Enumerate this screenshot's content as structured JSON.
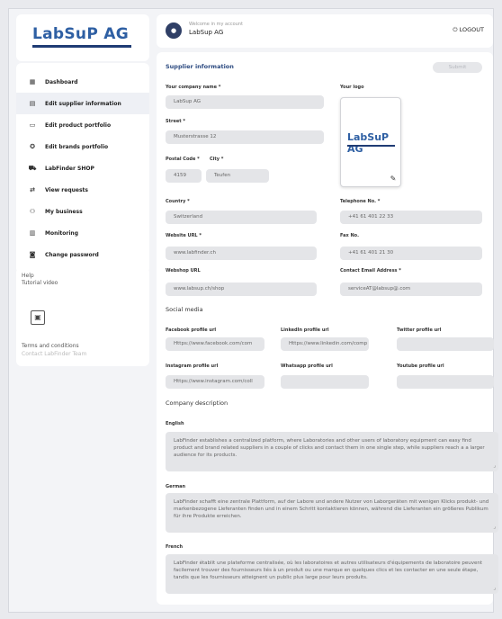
{
  "brand": {
    "logo_text": "LabSuP AG",
    "color": "#2e5fa3",
    "line_color": "#1f3c74"
  },
  "sidebar": {
    "items": [
      {
        "label": "Dashboard",
        "icon": "dashboard-icon"
      },
      {
        "label": "Edit supplier information",
        "icon": "supplier-icon",
        "active": true
      },
      {
        "label": "Edit product portfolio",
        "icon": "product-icon"
      },
      {
        "label": "Edit brands portfolio",
        "icon": "brands-icon"
      },
      {
        "label": "LabFinder SHOP",
        "icon": "shop-icon"
      },
      {
        "label": "View requests",
        "icon": "requests-icon"
      },
      {
        "label": "My business",
        "icon": "business-icon"
      },
      {
        "label": "Monitoring",
        "icon": "monitoring-icon"
      },
      {
        "label": "Change password",
        "icon": "password-icon"
      }
    ],
    "help": {
      "help": "Help",
      "tutorial": "Tutorial video",
      "terms": "Terms and conditions",
      "contact": "Contact LabFinder Team"
    }
  },
  "header": {
    "welcome": "Welcome in my account",
    "company": "LabSup AG",
    "logout": "LOGOUT"
  },
  "main": {
    "title": "Supplier information",
    "save": "Submit",
    "fields": {
      "company_label": "Your company name *",
      "company_value": "LabSup AG",
      "logo_label": "Your logo",
      "street_label": "Street *",
      "street_value": "Musterstrasse 12",
      "postal_label": "Postal Code *",
      "postal_value": "4159",
      "city_label": "City *",
      "city_value": "Teufen",
      "country_label": "Country *",
      "country_value": "Switzerland",
      "phone_label": "Telephone No. *",
      "phone_value": "+41 61 401 22 33",
      "website_label": "Website URL *",
      "website_value": "www.labfinder.ch",
      "fax_label": "Fax No.",
      "fax_value": "+41 61 401 21 30",
      "webshop_label": "Webshop URL",
      "webshop_value": "www.labsup.ch/shop",
      "email_label": "Contact Email Address *",
      "email_value": "serviceAT@labsup@.com"
    },
    "social": {
      "title": "Social media",
      "facebook_label": "Facebook profile url",
      "facebook_value": "Https://www.facebook.com/com",
      "linkedin_label": "LinkedIn profile url",
      "linkedin_value": "Https://www.linkedin.com/comp",
      "twitter_label": "Twitter profile url",
      "twitter_value": "",
      "instagram_label": "Instagram profile url",
      "instagram_value": "Https://www.instagram.com/coll",
      "whatsapp_label": "Whatsapp profile url",
      "whatsapp_value": "",
      "youtube_label": "Youtube profile url",
      "youtube_value": ""
    },
    "description": {
      "title": "Company description",
      "english_label": "English",
      "english_text": "LabFinder establishes a centralized platform, where Laboratories and other users of laboratory equipment can easy find product and brand related suppliers in a couple of clicks and contact them in one single step, while suppliers reach a a larger audience for its products.",
      "german_label": "German",
      "german_text": "LabFinder schafft eine zentrale Plattform, auf der Labore und andere Nutzer von Laborgeräten mit wenigen Klicks produkt- und markenbezogene Lieferanten finden und in einem Schritt kontaktieren können, während die Lieferanten ein größeres Publikum für ihre Produkte erreichen.",
      "french_label": "French",
      "french_text": "LabFinder établit une plateforme centralisée, où les laboratoires et autres utilisateurs d'équipements de laboratoire peuvent facilement trouver des fournisseurs liés à un produit ou une marque en quelques clics et les contacter en une seule étape, tandis que les fournisseurs atteignent un public plus large pour leurs produits."
    }
  }
}
